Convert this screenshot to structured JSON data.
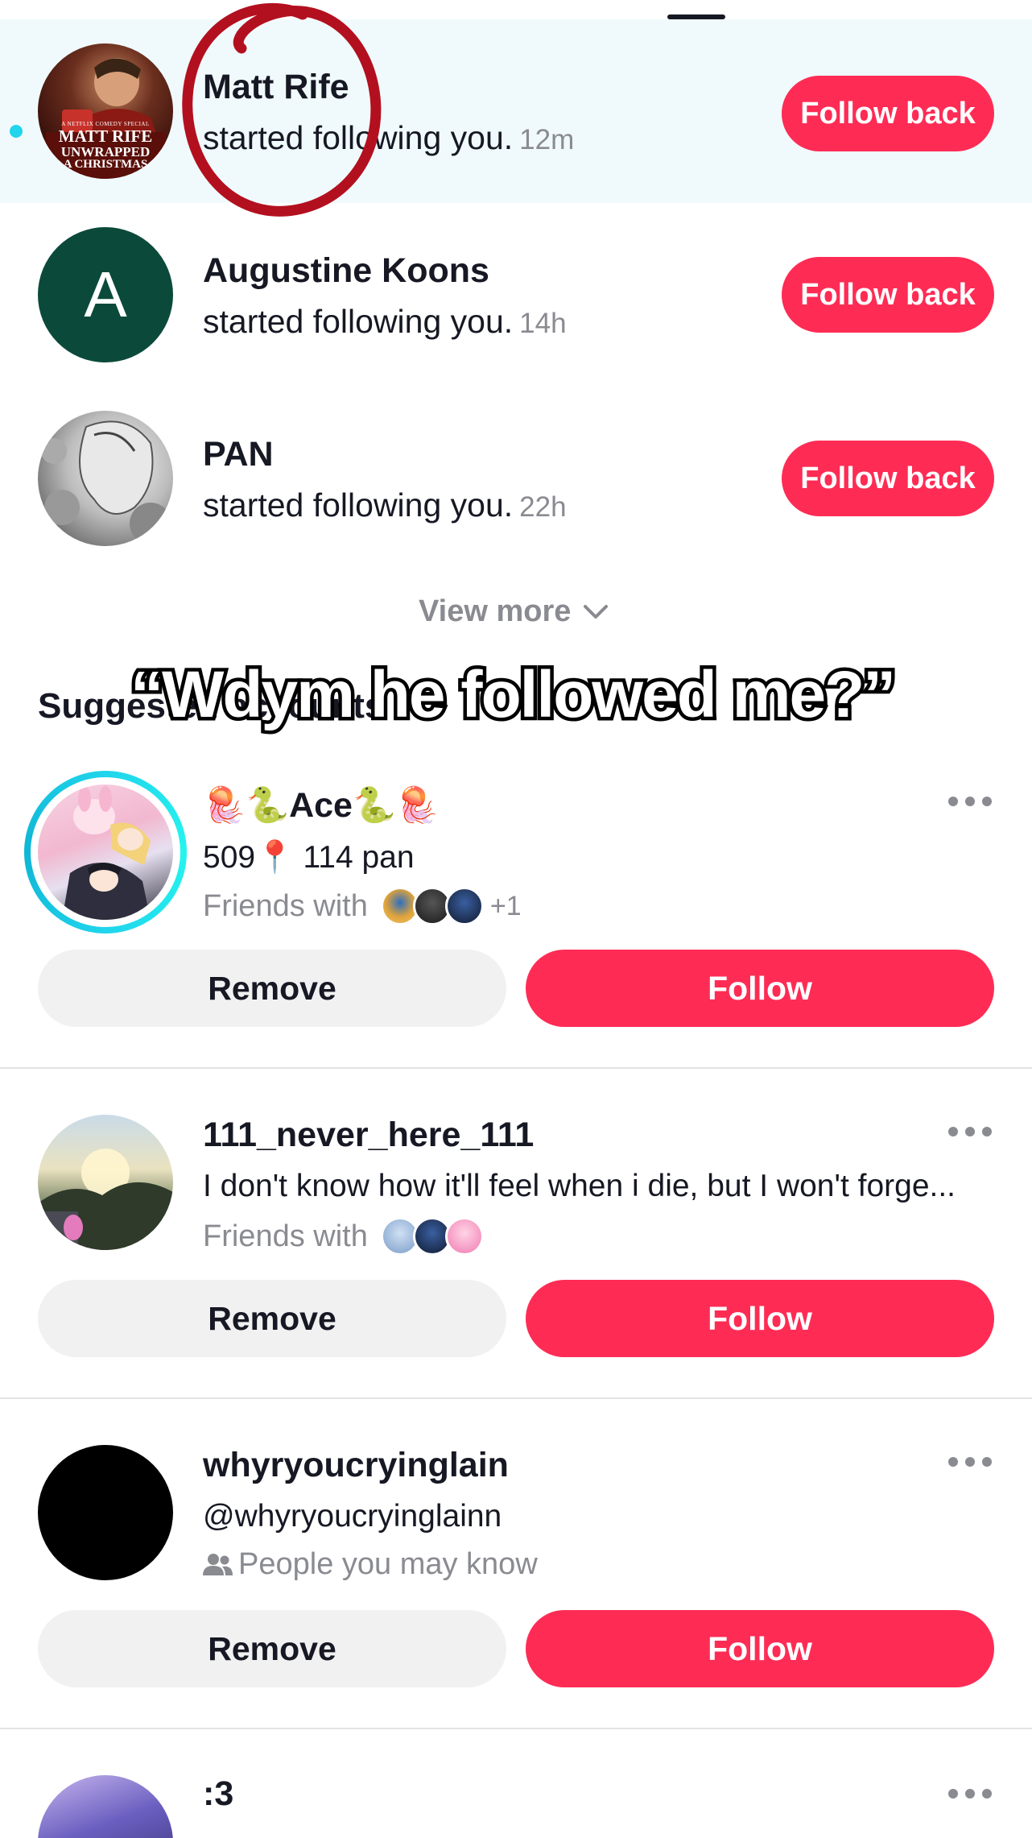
{
  "notifications": [
    {
      "name": "Matt Rife",
      "text": "started following you.",
      "time": "12m",
      "button": "Follow back",
      "avatar_text": [
        "A NETFLIX COMEDY SPECIAL",
        "MATT RIFE",
        "UNWRAPPED",
        "A CHRISTMAS"
      ]
    },
    {
      "name": "Augustine Koons",
      "text": "started following you.",
      "time": "14h",
      "button": "Follow back",
      "avatar_initial": "A"
    },
    {
      "name": "PAN",
      "text": "started following you.",
      "time": "22h",
      "button": "Follow back"
    }
  ],
  "view_more": "View more",
  "section_title": "Suggested accounts",
  "overlay_caption": "“Wdym he followed me?”",
  "suggestions": [
    {
      "name": "🪼🐍Ace🐍🪼",
      "line1": "509📍 114 pan",
      "line2_label": "Friends with",
      "extra_count": "+1",
      "remove": "Remove",
      "follow": "Follow"
    },
    {
      "name": "111_never_here_111",
      "line1": "I don't know how it'll feel when i die, but I won't forge...",
      "line2_label": "Friends with",
      "remove": "Remove",
      "follow": "Follow"
    },
    {
      "name": "whyryoucryinglain",
      "line1": "@whyryoucryinglainn",
      "line2_label": "People you may know",
      "remove": "Remove",
      "follow": "Follow"
    },
    {
      "name": ":3"
    }
  ],
  "icons": {
    "unread_dot": "unread-dot-icon",
    "chevron": "chevron-down-icon",
    "more": "more-horizontal-icon",
    "people": "people-icon",
    "pin": "pin-icon"
  },
  "colors": {
    "accent": "#fe2c55",
    "unread_bg": "#f0fafc",
    "unread_dot": "#20d5ec",
    "secondary_text": "#8a8b91",
    "remove_bg": "#f1f1f2",
    "circle_annotation": "#b3101f"
  }
}
